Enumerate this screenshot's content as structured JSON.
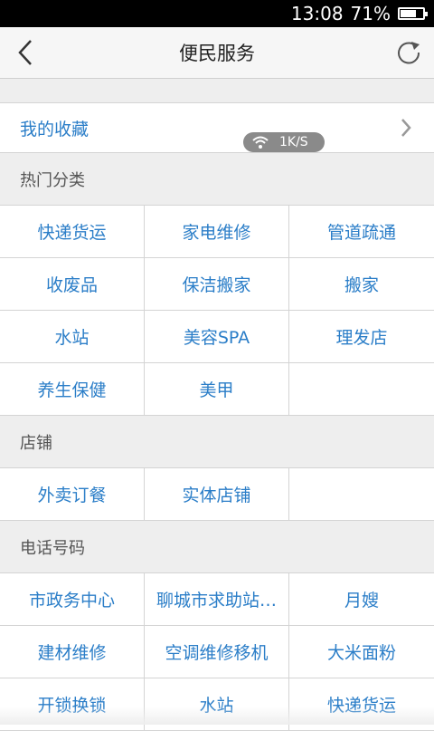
{
  "status": {
    "time": "13:08",
    "battery_percent": "71%",
    "battery_level": 0.71
  },
  "header": {
    "title": "便民服务",
    "back_icon": "back-arrow-icon",
    "refresh_icon": "refresh-icon"
  },
  "favorites": {
    "label": "我的收藏",
    "net_speed": "1K/S"
  },
  "sections": [
    {
      "title": "热门分类",
      "items": [
        "快递货运",
        "家电维修",
        "管道疏通",
        "收废品",
        "保洁搬家",
        "搬家",
        "水站",
        "美容SPA",
        "理发店",
        "养生保健",
        "美甲",
        ""
      ]
    },
    {
      "title": "店铺",
      "items": [
        "外卖订餐",
        "实体店铺",
        ""
      ]
    },
    {
      "title": "电话号码",
      "items": [
        "市政务中心",
        "聊城市求助站…",
        "月嫂",
        "建材维修",
        "空调维修移机",
        "大米面粉",
        "开锁换锁",
        "水站",
        "快递货运"
      ]
    }
  ]
}
